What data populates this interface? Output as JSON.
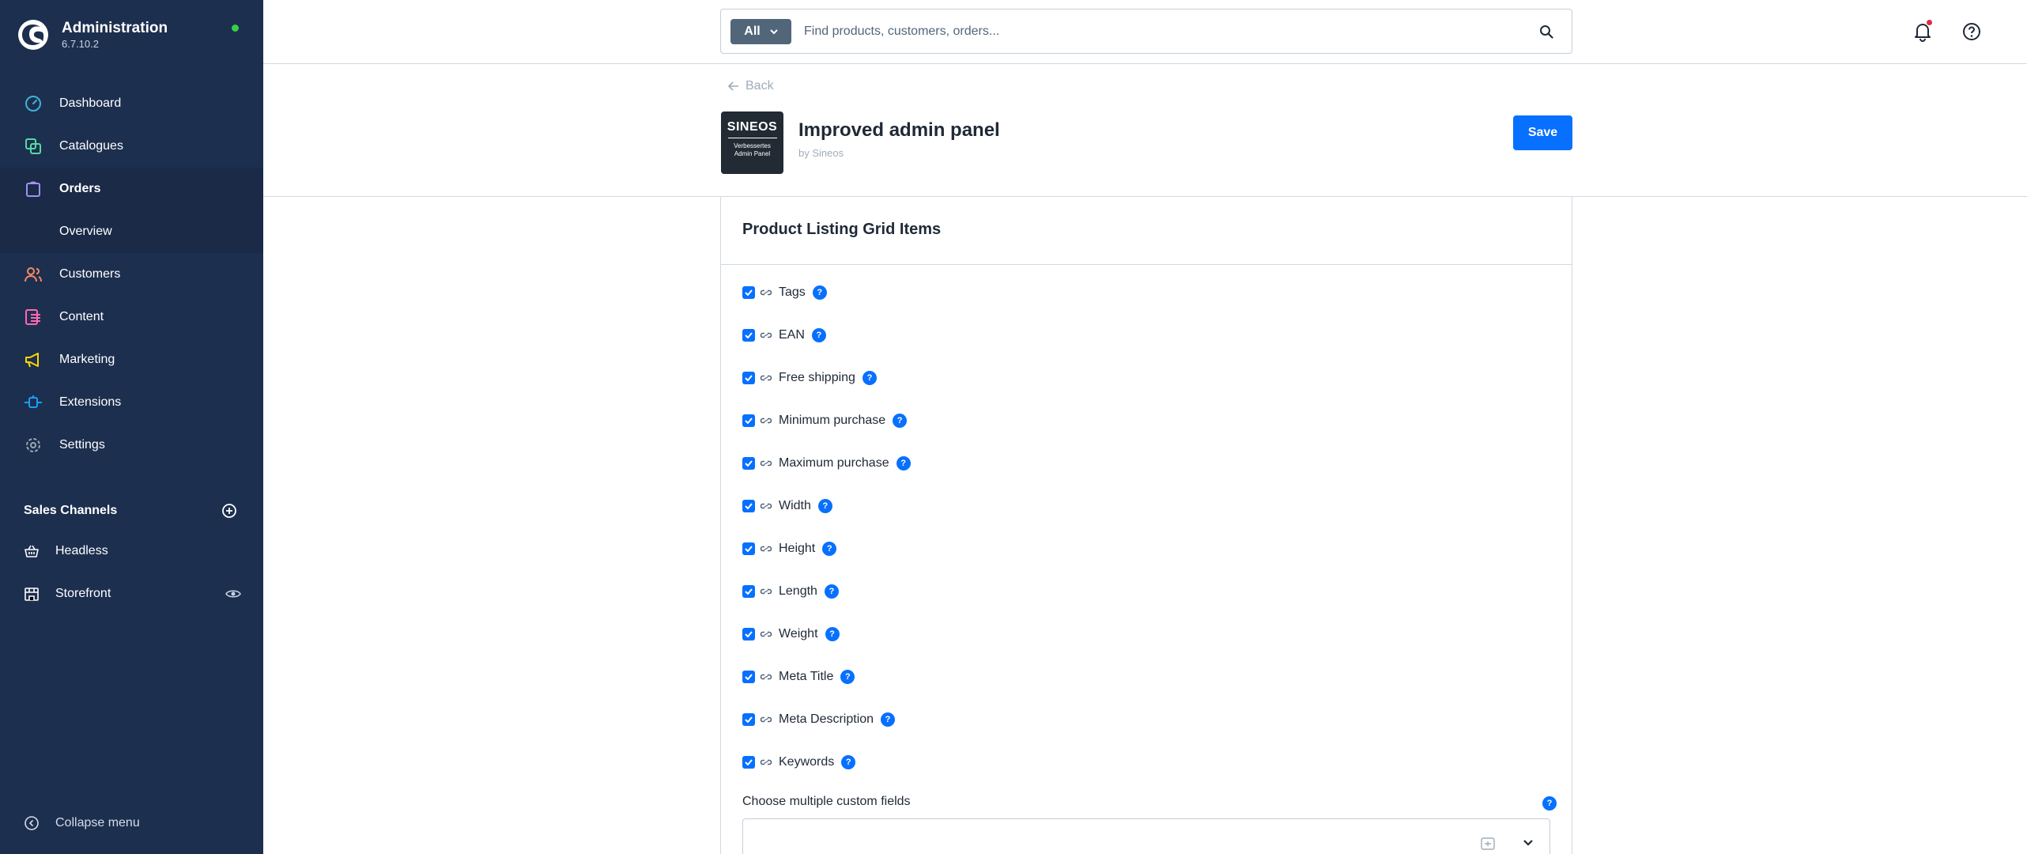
{
  "app": {
    "title": "Administration",
    "version": "6.7.10.2"
  },
  "sidebar": {
    "items": [
      {
        "label": "Dashboard",
        "icon": "gauge-icon",
        "color": "#3fb4d8"
      },
      {
        "label": "Catalogues",
        "icon": "catalogue-icon",
        "color": "#57d9a3"
      },
      {
        "label": "Orders",
        "icon": "shopping-bag-icon",
        "color": "#a092f0"
      },
      {
        "label": "Customers",
        "icon": "users-icon",
        "color": "#f88962"
      },
      {
        "label": "Content",
        "icon": "content-icon",
        "color": "#ff68b4"
      },
      {
        "label": "Marketing",
        "icon": "megaphone-icon",
        "color": "#ffd700"
      },
      {
        "label": "Extensions",
        "icon": "plug-icon",
        "color": "#189eff"
      },
      {
        "label": "Settings",
        "icon": "gear-icon",
        "color": "#9aa8b5"
      }
    ],
    "orders_sub": {
      "label": "Overview"
    },
    "sales_channels": {
      "title": "Sales Channels",
      "items": [
        {
          "label": "Headless",
          "icon": "basket-icon"
        },
        {
          "label": "Storefront",
          "icon": "storefront-icon"
        }
      ]
    },
    "collapse_label": "Collapse menu"
  },
  "header": {
    "search": {
      "type_label": "All",
      "placeholder": "Find products, customers, orders..."
    }
  },
  "smartbar": {
    "back_label": "Back",
    "extension": {
      "logo_line1": "SINEOS",
      "logo_line2": "Verbessertes",
      "logo_line3": "Admin Panel",
      "title": "Improved admin panel",
      "by": "by Sineos"
    },
    "save_label": "Save"
  },
  "card": {
    "title": "Product Listing Grid Items",
    "options": [
      {
        "label": "Tags",
        "checked": true
      },
      {
        "label": "EAN",
        "checked": true
      },
      {
        "label": "Free shipping",
        "checked": true
      },
      {
        "label": "Minimum purchase",
        "checked": true
      },
      {
        "label": "Maximum purchase",
        "checked": true
      },
      {
        "label": "Width",
        "checked": true
      },
      {
        "label": "Height",
        "checked": true
      },
      {
        "label": "Length",
        "checked": true
      },
      {
        "label": "Weight",
        "checked": true
      },
      {
        "label": "Meta Title",
        "checked": true
      },
      {
        "label": "Meta Description",
        "checked": true
      },
      {
        "label": "Keywords",
        "checked": true
      }
    ],
    "custom_fields": {
      "label": "Choose multiple custom fields",
      "help": "?"
    },
    "help_mark": "?"
  },
  "colors": {
    "sidebar_bg": "#1d2f4f",
    "accent": "#0870ff",
    "status_online": "#37d046",
    "notification": "#de294c"
  }
}
